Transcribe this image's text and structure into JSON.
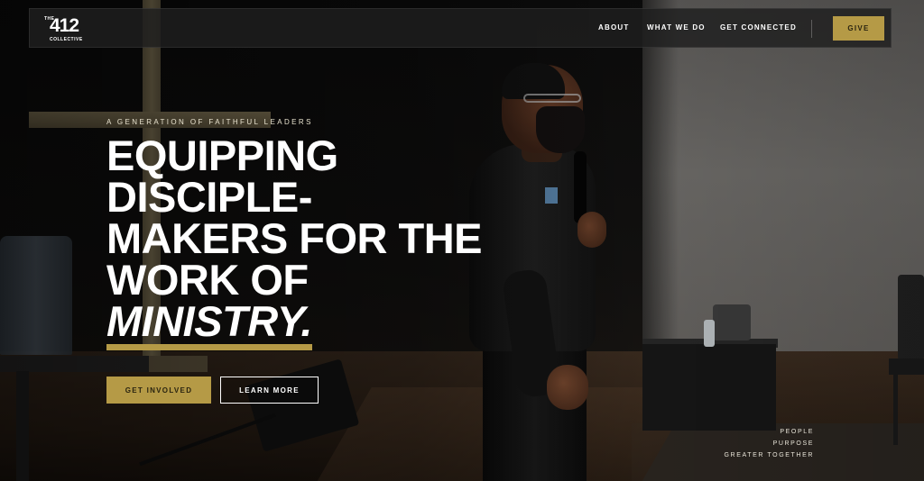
{
  "header": {
    "logo": {
      "top": "THE",
      "number": "412",
      "sub": "COLLECTIVE"
    },
    "nav": [
      "ABOUT",
      "WHAT WE DO",
      "GET CONNECTED"
    ],
    "give_label": "GIVE"
  },
  "hero": {
    "eyebrow": "A GENERATION OF FAITHFUL LEADERS",
    "headline_lines": [
      "EQUIPPING",
      "DISCIPLE-",
      "MAKERS FOR THE",
      "WORK OF"
    ],
    "headline_accent": "MINISTRY.",
    "primary_button": "GET INVOLVED",
    "secondary_button": "LEARN MORE"
  },
  "tagline": [
    "PEOPLE",
    "PURPOSE",
    "GREATER TOGETHER"
  ],
  "colors": {
    "accent": "#b59a46",
    "header_bg": "#1e1e1e",
    "text": "#ffffff"
  }
}
